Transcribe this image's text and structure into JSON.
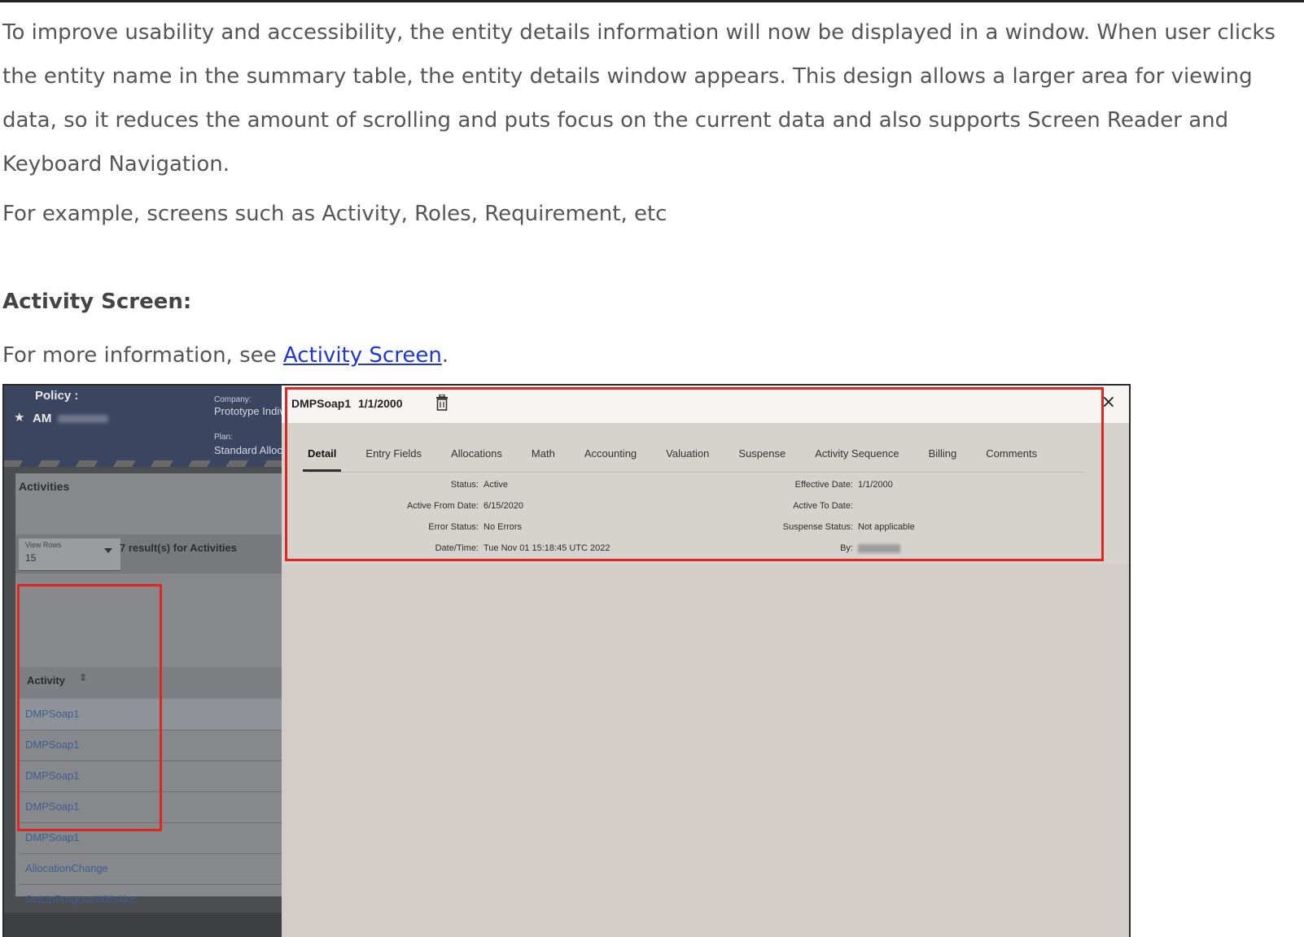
{
  "doc": {
    "paragraph1": "To improve usability and accessibility, the entity details information will now be displayed in a window. When user clicks the entity name in the summary table, the entity details window appears. This design allows a larger area for viewing data, so it reduces the amount of scrolling and puts focus on the current data and also supports Screen Reader and Keyboard Navigation.",
    "paragraph2": "For example, screens such as Activity, Roles, Requirement, etc",
    "heading": "Activity Screen:",
    "para3_prefix": "For more information, see ",
    "para3_link": "Activity Screen",
    "para3_suffix": "."
  },
  "app": {
    "policy_label": "Policy :",
    "policy_name": "AM",
    "company_label": "Company:",
    "company_value": "Prototype Indiv",
    "plan_label": "Plan:",
    "plan_value": "Standard Alloc",
    "activities_title": "Activities",
    "view_rows_label": "View Rows",
    "view_rows_value": "15",
    "result_count": "7 result(s) for Activities",
    "column_header": "Activity",
    "rows": [
      "DMPSoap1",
      "DMPSoap1",
      "DMPSoap1",
      "DMPSoap1",
      "DMPSoap1",
      "AllocationChange",
      "SetUpProgramWithAloc"
    ]
  },
  "dialog": {
    "title": "DMPSoap1",
    "date": "1/1/2000",
    "close_glyph": "×",
    "tabs": [
      "Detail",
      "Entry Fields",
      "Allocations",
      "Math",
      "Accounting",
      "Valuation",
      "Suspense",
      "Activity Sequence",
      "Billing",
      "Comments"
    ],
    "active_tab": "Detail",
    "left_fields": [
      {
        "label": "Status:",
        "value": "Active"
      },
      {
        "label": "Active From Date:",
        "value": "6/15/2020"
      },
      {
        "label": "Error Status:",
        "value": "No Errors"
      },
      {
        "label": "Date/Time:",
        "value": "Tue Nov 01 15:18:45 UTC 2022"
      }
    ],
    "right_fields": [
      {
        "label": "Effective Date:",
        "value": "1/1/2000"
      },
      {
        "label": "Active To Date:",
        "value": ""
      },
      {
        "label": "Suspense Status:",
        "value": "Not applicable"
      },
      {
        "label": "By:",
        "value": ""
      }
    ]
  },
  "colors": {
    "link": "#1f35d6",
    "highlight_box": "#e0261f",
    "app_header": "#3a4660"
  }
}
